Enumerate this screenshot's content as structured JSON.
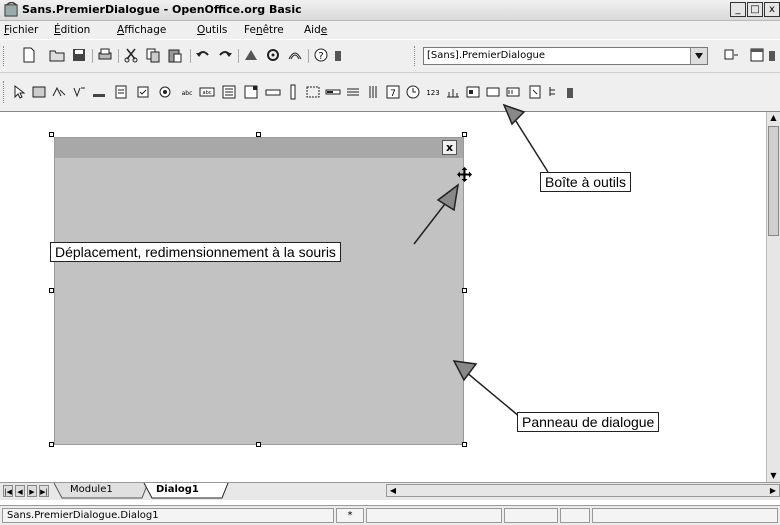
{
  "window": {
    "title": "Sans.PremierDialogue - OpenOffice.org Basic",
    "controls": [
      "_",
      "□",
      "x"
    ]
  },
  "menubar": [
    {
      "pre": "",
      "ul": "F",
      "post": "ichier"
    },
    {
      "pre": "",
      "ul": "É",
      "post": "dition"
    },
    {
      "pre": "",
      "ul": "A",
      "post": "ffichage"
    },
    {
      "pre": "",
      "ul": "O",
      "post": "utils"
    },
    {
      "pre": "Fe",
      "ul": "n",
      "post": "être"
    },
    {
      "pre": "Aid",
      "ul": "e",
      "post": ""
    }
  ],
  "toolbar": {
    "library_combo_value": "[Sans].PremierDialogue"
  },
  "editor": {
    "dialog_close_glyph": "x",
    "callouts": {
      "toolbox": "Boîte à outils",
      "move_resize": "Déplacement, redimensionnement à la souris",
      "dialog_panel": "Panneau de dialogue"
    }
  },
  "tabs": {
    "module1": "Module1",
    "dialog1": "Dialog1"
  },
  "statusbar": {
    "location": "Sans.PremierDialogue.Dialog1",
    "modified_mark": "*"
  }
}
